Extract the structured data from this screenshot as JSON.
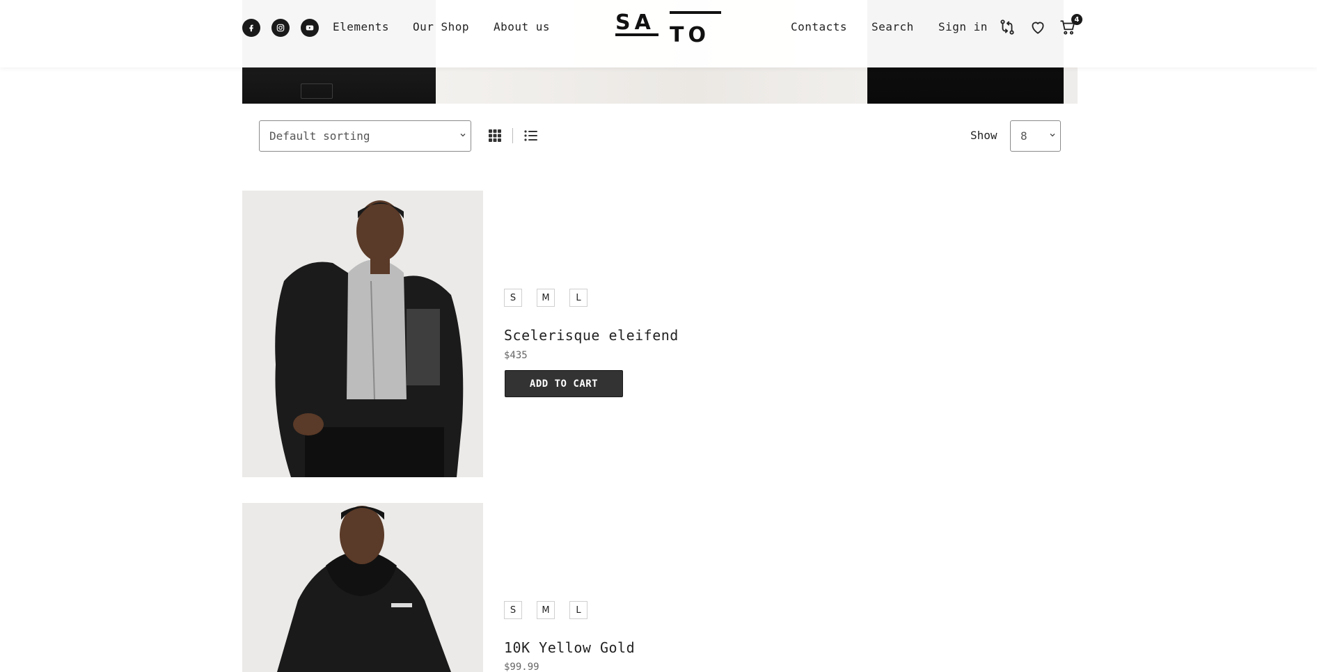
{
  "header": {
    "nav_left": [
      "Elements",
      "Our Shop",
      "About us"
    ],
    "nav_right": [
      "Contacts",
      "Search",
      "Sign in"
    ],
    "logo_text": "SATO",
    "cart_count": "4",
    "social_icons": [
      "facebook-icon",
      "instagram-icon",
      "youtube-icon"
    ]
  },
  "toolbar": {
    "sort_value": "Default sorting",
    "show_label": "Show",
    "show_value": "8",
    "view_modes": [
      "grid-view-icon",
      "list-view-icon"
    ]
  },
  "products": [
    {
      "title": "Scelerisque eleifend",
      "price": "$435",
      "sizes": [
        "S",
        "M",
        "L"
      ],
      "button": "ADD TO CART"
    },
    {
      "title": "10K Yellow Gold",
      "price": "$99.99",
      "sizes": [
        "S",
        "M",
        "L"
      ]
    }
  ],
  "colors": {
    "accent": "#333333",
    "text": "#222222",
    "price": "#666666",
    "image_bg": "#ebeae8"
  }
}
